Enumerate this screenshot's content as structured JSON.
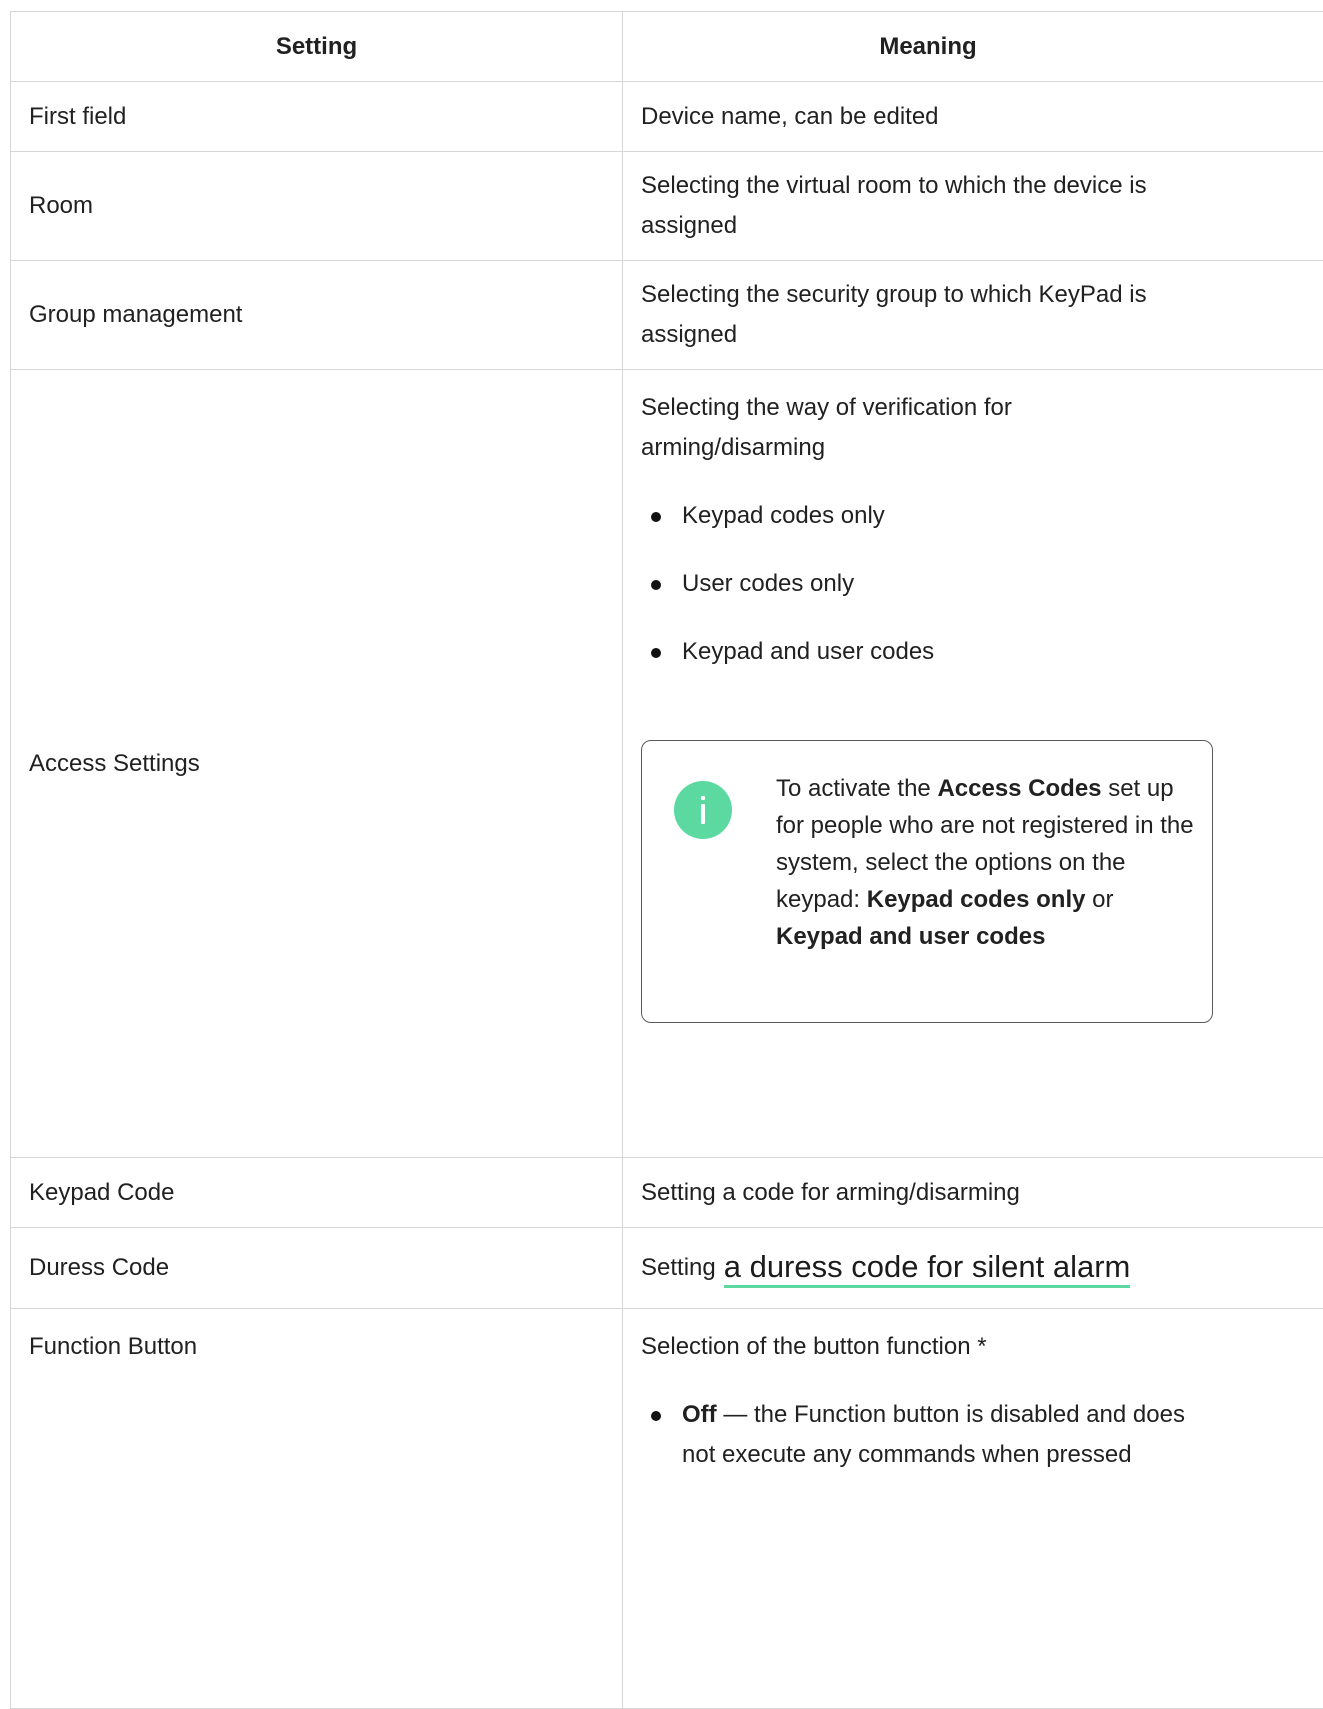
{
  "table": {
    "headers": {
      "setting": "Setting",
      "meaning": "Meaning"
    },
    "rows": {
      "first_field": {
        "setting": "First field",
        "meaning": "Device name, can be edited"
      },
      "room": {
        "setting": "Room",
        "meaning": "Selecting the virtual room to which the device is assigned"
      },
      "group": {
        "setting": "Group management",
        "meaning": "Selecting the security group to which KeyPad is assigned"
      },
      "access": {
        "setting": "Access Settings",
        "meaning": "Selecting the way of verification for arming/disarming",
        "options": [
          "Keypad codes only",
          "User codes only",
          "Keypad and user codes"
        ],
        "note": {
          "icon": "info-icon",
          "t1": "To activate the ",
          "b1": "Access Codes",
          "t2": " set up for people who are not registered in the system, select the options on the keypad: ",
          "b2": "Keypad codes only",
          "t3": " or ",
          "b3": "Keypad and user codes"
        }
      },
      "keypad_code": {
        "setting": "Keypad Code",
        "meaning": "Setting a code for arming/disarming"
      },
      "duress": {
        "setting": "Duress Code",
        "prefix": "Setting",
        "link": "a duress code for silent alarm"
      },
      "function": {
        "setting": "Function Button",
        "meaning": "Selection of the button function *",
        "off_label": "Off",
        "off_text": " — the Function button is disabled and does not execute any commands when pressed"
      }
    }
  },
  "colors": {
    "accent": "#5bd9a0",
    "border": "#d6d6d6",
    "text": "#212121"
  }
}
